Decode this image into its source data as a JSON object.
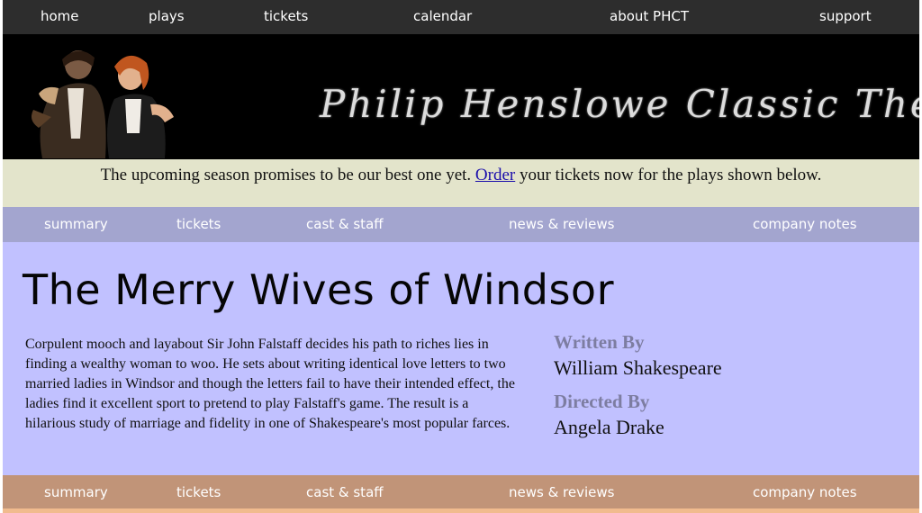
{
  "top_nav": {
    "items": [
      "home",
      "plays",
      "tickets",
      "calendar",
      "about PHCT",
      "support"
    ]
  },
  "banner": {
    "brand": "Philip Henslowe Classic Theatre",
    "photo_icon": "actors-photo"
  },
  "announcement": {
    "before": "The upcoming season promises to be our best one yet. ",
    "link": "Order",
    "after": " your tickets now for the plays shown below."
  },
  "sub_nav": {
    "items": [
      "summary",
      "tickets",
      "cast & staff",
      "news & reviews",
      "company notes"
    ]
  },
  "play": {
    "title": "The Merry Wives of Windsor",
    "description": "Corpulent mooch and layabout Sir John Falstaff decides his path to riches lies in finding a wealthy woman to woo. He sets about writing identical love letters to two married ladies in Windsor and though the letters fail to have their intended effect, the ladies find it excellent sport to pretend to play Falstaff's game. The result is a hilarious study of marriage and fidelity in one of Shakespeare's most popular farces.",
    "written_by_label": "Written By",
    "written_by": "William Shakespeare",
    "directed_by_label": "Directed By",
    "directed_by": "Angela Drake"
  },
  "colors": {
    "top_nav": "#2d2d2d",
    "announcement_bg": "#e3e4cb",
    "sub_nav_top": "#a3a5cf",
    "main_bg": "#c1c1ff",
    "sub_nav_bottom": "#c19478",
    "label": "#7d7da1"
  }
}
